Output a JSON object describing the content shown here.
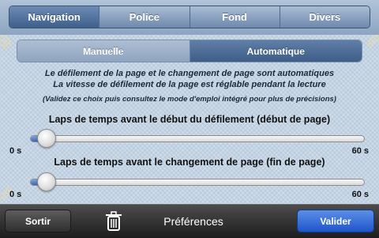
{
  "top_tabs": [
    {
      "label": "Navigation",
      "active": true
    },
    {
      "label": "Police",
      "active": false
    },
    {
      "label": "Fond",
      "active": false
    },
    {
      "label": "Divers",
      "active": false
    }
  ],
  "mode_tabs": [
    {
      "label": "Manuelle",
      "active": false
    },
    {
      "label": "Automatique",
      "active": true
    }
  ],
  "description": {
    "line1": "Le défilement de la page et le changement de page sont automatiques",
    "line2": "La vitesse de défilement de la page est réglable pendant la lecture",
    "line3": "(Validez ce choix puis consultez le mode d'emploi intégré pour plus de précisions)"
  },
  "sliders": [
    {
      "label": "Laps de temps avant le début du défilement (début de page)",
      "min_label": "0 s",
      "max_label": "60 s",
      "value_fraction": 0.04
    },
    {
      "label": "Laps de temps avant le changement de page (fin de page)",
      "min_label": "0 s",
      "max_label": "60 s",
      "value_fraction": 0.04
    }
  ],
  "toolbar": {
    "sortir_label": "Sortir",
    "title": "Préférences",
    "valider_label": "Valider",
    "trash_icon": "trash-icon"
  },
  "colors": {
    "accent_blue": "#2a5fd0",
    "active_tab": "#4a6a96"
  }
}
